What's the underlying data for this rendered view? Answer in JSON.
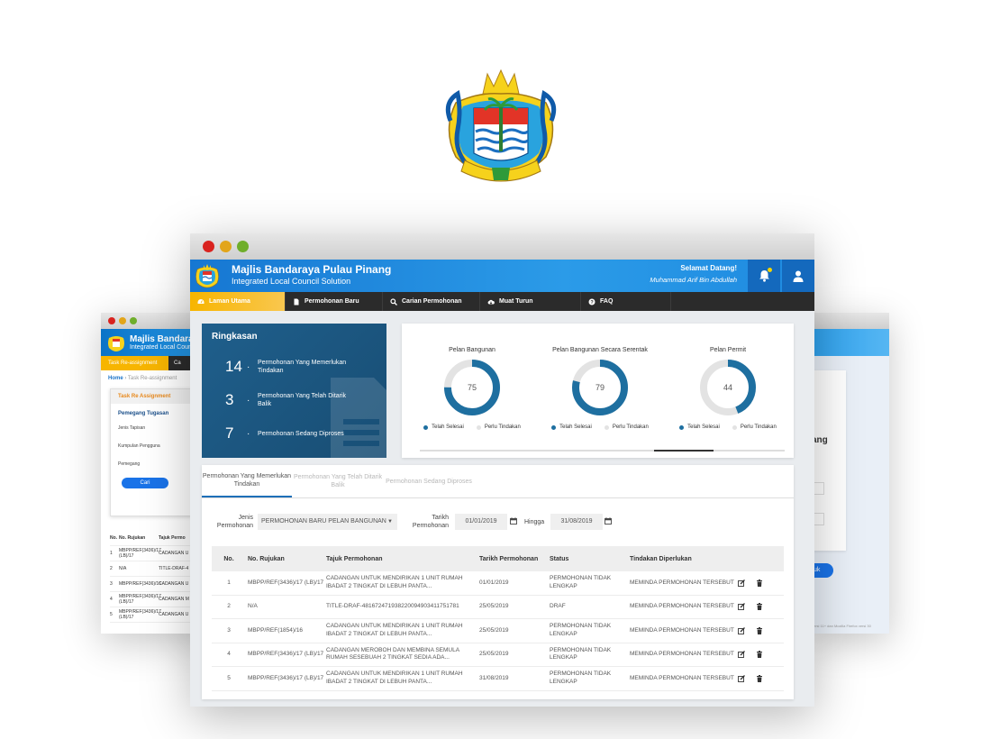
{
  "app": {
    "title": "Majlis Bandaraya Pulau Pinang",
    "subtitle": "Integrated Local Council Solution",
    "greeting": "Selamat Datang!",
    "user_name": "Muhammad Arif Bin Abdullah",
    "colors": {
      "header": "#1677d2",
      "nav_bg": "#2b2b2b",
      "nav_active": "#f7b500",
      "summary_bg": "#1f5f8c",
      "donut_done": "#1e6fa0",
      "donut_pending": "#e3e3e3"
    },
    "crest_text": [
      "BEKERJASAMA",
      "BERKHIDMAT",
      "SAMBIL"
    ]
  },
  "nav": {
    "items": [
      {
        "label": "Laman Utama",
        "icon": "dashboard-icon"
      },
      {
        "label": "Permohonan Baru",
        "icon": "document-icon"
      },
      {
        "label": "Carian Permohonan",
        "icon": "search-icon"
      },
      {
        "label": "Muat Turun",
        "icon": "cloud-download-icon"
      },
      {
        "label": "FAQ",
        "icon": "help-icon"
      }
    ]
  },
  "summary": {
    "title": "Ringkasan",
    "rows": [
      {
        "count": "14",
        "label": "Permohonan Yang Memerlukan Tindakan"
      },
      {
        "count": "3",
        "label": "Permohonan Yang Telah Ditarik Balik"
      },
      {
        "count": "7",
        "label": "Permohonan Sedang Diproses"
      }
    ]
  },
  "charts": {
    "legend_done": "Telah Selesai",
    "legend_pending": "Perlu Tindakan",
    "items": [
      {
        "title": "Pelan Bangunan",
        "value": "75",
        "done_fraction": 0.75
      },
      {
        "title": "Pelan Bangunan Secara Serentak",
        "value": "79",
        "done_fraction": 0.79
      },
      {
        "title": "Pelan Permit",
        "value": "44",
        "done_fraction": 0.44
      }
    ]
  },
  "tabs": [
    {
      "label": "Permohonan Yang Memerlukan Tindakan",
      "active": true
    },
    {
      "label": "Permohonan Yang Telah Ditarik Balik",
      "active": false
    },
    {
      "label": "Permohonan Sedang Diproses",
      "active": false
    }
  ],
  "filters": {
    "type_label": "Jenis Permohonan",
    "type_value": "PERMOHONAN BARU PELAN BANGUNAN",
    "date_label": "Tarikh Permohonan",
    "date_from": "01/01/2019",
    "until_label": "Hingga",
    "date_to": "31/08/2019"
  },
  "table": {
    "headers": [
      "No.",
      "No. Rujukan",
      "Tajuk Permohonan",
      "Tarikh Permohonan",
      "Status",
      "Tindakan Diperlukan"
    ],
    "rows": [
      {
        "no": "1",
        "ref": "MBPP/REF(3436)/17 (LB)/17",
        "title": "CADANGAN UNTUK MENDIRIKAN 1 UNIT RUMAH IBADAT 2 TINGKAT DI LEBUH PANTA...",
        "date": "01/01/2019",
        "status": "PERMOHONAN TIDAK LENGKAP",
        "action": "MEMINDA PERMOHONAN TERSEBUT"
      },
      {
        "no": "2",
        "ref": "N/A",
        "title": "TITLE-DRAF-481672471938220094903411751781",
        "date": "25/05/2019",
        "status": "DRAF",
        "action": "MEMINDA PERMOHONAN TERSEBUT"
      },
      {
        "no": "3",
        "ref": "MBPP/REF(1854)/16",
        "title": "CADANGAN UNTUK MENDIRIKAN 1 UNIT RUMAH IBADAT 2 TINGKAT DI LEBUH PANTA...",
        "date": "25/05/2019",
        "status": "PERMOHONAN TIDAK LENGKAP",
        "action": "MEMINDA PERMOHONAN TERSEBUT"
      },
      {
        "no": "4",
        "ref": "MBPP/REF(3436)/17 (LB)/17",
        "title": "CADANGAN MEROBOH DAN MEMBINA SEMULA RUMAH SESEBUAH 2 TINGKAT SEDIA ADA...",
        "date": "25/05/2019",
        "status": "PERMOHONAN TIDAK LENGKAP",
        "action": "MEMINDA PERMOHONAN TERSEBUT"
      },
      {
        "no": "5",
        "ref": "MBPP/REF(3436)/17 (LB)/17",
        "title": "CADANGAN UNTUK MENDIRIKAN 1 UNIT RUMAH IBADAT 2 TINGKAT DI LEBUH PANTA...",
        "date": "31/08/2019",
        "status": "PERMOHONAN TIDAK LENGKAP",
        "action": "MEMINDA PERMOHONAN TERSEBUT"
      }
    ]
  },
  "left_window": {
    "title": "Majlis Bandaraya",
    "subtitle": "Integrated Local Counci",
    "nav_active": "Task Re-assignment",
    "breadcrumb_home": "Home",
    "breadcrumb_current": "Task Re-assignment",
    "card_title": "Task Re Assignment",
    "section": "Pemegang Tugasan",
    "fields": [
      "Jenis Tapisan",
      "Kumpulan Pengguna",
      "Pemegang"
    ],
    "search_button": "Cari",
    "table_headers": [
      "No.",
      "No. Rujukan",
      "Tajuk Permo"
    ],
    "table_rows": [
      [
        "1",
        "MBPP/REF(3436)/17 (LB)/17",
        "CADANGAN U 2 TINGKAT DI"
      ],
      [
        "2",
        "N/A",
        "TITLE-DRAF-4"
      ],
      [
        "3",
        "MBPP/REF(3436)/16",
        "CADANGAN U 2 TINGKAT DI"
      ],
      [
        "4",
        "MBPP/REF(3436)/17 (LB)/17",
        "CADANGAN M SESEBUAH 2 T"
      ],
      [
        "5",
        "MBPP/REF(3436)/17 (LB)/17",
        "CADANGAN U 2 TINGKAT DI"
      ]
    ]
  },
  "right_window": {
    "heading_fragment": "ang",
    "button_fragment": "uk",
    "footer_fragment": "ersi 11+ dan Mozilla Firefox versi 30"
  }
}
